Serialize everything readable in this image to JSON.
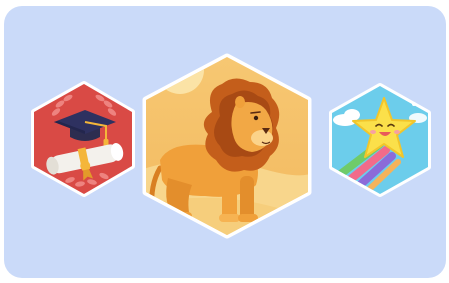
{
  "card": {
    "background_color": "#CADAF9"
  },
  "badges": [
    {
      "name": "graduation",
      "icon": "graduation-cap-diploma-icon",
      "background_color": "#D94A45"
    },
    {
      "name": "lion",
      "icon": "lion-icon",
      "background_color": "#F6C974"
    },
    {
      "name": "star",
      "icon": "shooting-star-icon",
      "background_color": "#6CCDEB"
    }
  ]
}
